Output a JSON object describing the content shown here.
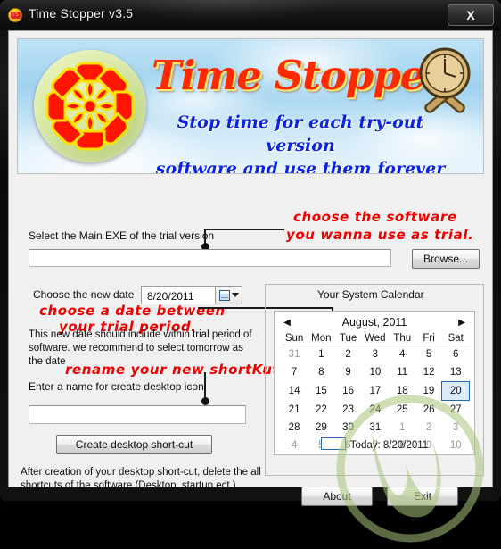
{
  "window": {
    "title": "Time Stopper v3.5",
    "close_label": "X",
    "app_icon": "time-stopper-badge-icon"
  },
  "banner": {
    "title": "Time Stopper",
    "subtitle_line1": "Stop time for each try-out version",
    "subtitle_line2": "software and use them forever",
    "logo_icon": "mandala-disc-logo",
    "clock_icon": "clock-with-tools-icon",
    "title_color": "#ff2a00",
    "subtitle_color": "#0a23e0"
  },
  "exe_section": {
    "label": "Select the Main EXE of the trial version",
    "input_value": "",
    "input_placeholder": "",
    "browse_label": "Browse...",
    "annotation_line1": "choose the software",
    "annotation_line2": "you wanna use as trial."
  },
  "date_section": {
    "label": "Choose the new date",
    "date_value": "8/20/2011",
    "annotation_line1": "choose a date between",
    "annotation_line2": "your trial period.",
    "hint": "This new date should include within trial period of software. we recommend to select tomorrow as the date",
    "calendar_icon": "calendar-icon",
    "dropdown_icon": "chevron-down-icon"
  },
  "shortcut_section": {
    "annotation": "rename your new shortKut",
    "label": "Enter a name for create desktop icon",
    "input_value": "",
    "input_placeholder": "",
    "button_label": "Create desktop short-cut",
    "footer": "After creation of your desktop short-cut, delete the all shortcuts of the software (Desktop, startup ect.)"
  },
  "calendar": {
    "group_title": "Your System Calendar",
    "month_title": "August, 2011",
    "prev_icon": "arrow-left-icon",
    "next_icon": "arrow-right-icon",
    "day_headers": [
      "Sun",
      "Mon",
      "Tue",
      "Wed",
      "Thu",
      "Fri",
      "Sat"
    ],
    "weeks": [
      [
        {
          "d": "31",
          "dim": true
        },
        {
          "d": "1"
        },
        {
          "d": "2"
        },
        {
          "d": "3"
        },
        {
          "d": "4"
        },
        {
          "d": "5"
        },
        {
          "d": "6"
        }
      ],
      [
        {
          "d": "7"
        },
        {
          "d": "8"
        },
        {
          "d": "9"
        },
        {
          "d": "10"
        },
        {
          "d": "11"
        },
        {
          "d": "12"
        },
        {
          "d": "13"
        }
      ],
      [
        {
          "d": "14"
        },
        {
          "d": "15"
        },
        {
          "d": "16"
        },
        {
          "d": "17"
        },
        {
          "d": "18"
        },
        {
          "d": "19"
        },
        {
          "d": "20",
          "sel": true
        }
      ],
      [
        {
          "d": "21"
        },
        {
          "d": "22"
        },
        {
          "d": "23"
        },
        {
          "d": "24"
        },
        {
          "d": "25"
        },
        {
          "d": "26"
        },
        {
          "d": "27"
        }
      ],
      [
        {
          "d": "28"
        },
        {
          "d": "29"
        },
        {
          "d": "30"
        },
        {
          "d": "31"
        },
        {
          "d": "1",
          "dim": true
        },
        {
          "d": "2",
          "dim": true
        },
        {
          "d": "3",
          "dim": true
        }
      ],
      [
        {
          "d": "4",
          "dim": true
        },
        {
          "d": "5",
          "dim": true
        },
        {
          "d": "6",
          "dim": true
        },
        {
          "d": "7",
          "dim": true
        },
        {
          "d": "8",
          "dim": true
        },
        {
          "d": "9",
          "dim": true
        },
        {
          "d": "10",
          "dim": true
        }
      ]
    ],
    "today_label": "Today: 8/20/2011",
    "selected_day": "20",
    "selection_color": "#2a6ab5"
  },
  "footer_buttons": {
    "about_label": "About",
    "exit_label": "Exit"
  },
  "watermark": {
    "icon": "green-circular-watermark-logo",
    "color": "#a8c47a"
  }
}
